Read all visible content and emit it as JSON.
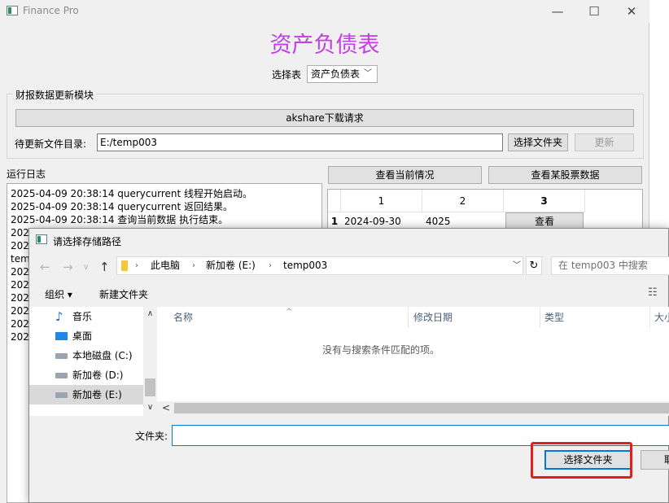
{
  "main_window": {
    "app_title": "Finance Pro",
    "heading": "资产负债表",
    "select_label": "选择表",
    "select_value": "资产负债表",
    "group_title": "财报数据更新模块",
    "akshare_button": "akshare下载请求",
    "dir_label": "待更新文件目录:",
    "dir_value": "E:/temp003",
    "choose_folder_button": "选择文件夹",
    "update_button": "更新",
    "log_label": "运行日志",
    "view_current_button": "查看当前情况",
    "view_stock_button": "查看某股票数据",
    "log_lines": [
      "2025-04-09 20:38:14 querycurrent 线程开始启动。",
      "2025-04-09 20:38:14 querycurrent 返回结果。",
      "2025-04-09 20:38:14 查询当前数据 执行结束。",
      "202",
      "202",
      "tem",
      "202",
      "202",
      "202",
      "202",
      "202",
      "202"
    ],
    "table": {
      "headers": [
        "1",
        "2",
        "3"
      ],
      "rows": [
        {
          "row": "1",
          "col1": "2024-09-30",
          "col2": "4025",
          "col3": "查看"
        }
      ]
    }
  },
  "dialog": {
    "title": "请选择存储路径",
    "breadcrumbs": [
      "此电脑",
      "新加卷 (E:)",
      "temp003"
    ],
    "search_placeholder": "在 temp003 中搜索",
    "organize": "组织 ▾",
    "new_folder": "新建文件夹",
    "nav_items": [
      {
        "label": "音乐",
        "icon": "music-icon"
      },
      {
        "label": "桌面",
        "icon": "desktop-icon"
      },
      {
        "label": "本地磁盘 (C:)",
        "icon": "drive-icon"
      },
      {
        "label": "新加卷 (D:)",
        "icon": "drive-icon"
      },
      {
        "label": "新加卷 (E:)",
        "icon": "drive-icon",
        "selected": true
      }
    ],
    "columns": [
      "名称",
      "修改日期",
      "类型",
      "大小"
    ],
    "empty_message": "没有与搜索条件匹配的项。",
    "folder_label": "文件夹:",
    "folder_value": "",
    "select_button": "选择文件夹",
    "cancel_button": "取消"
  },
  "colors": {
    "heading": "#c040e0",
    "highlight": "#e0201e",
    "focus": "#0078d7"
  }
}
